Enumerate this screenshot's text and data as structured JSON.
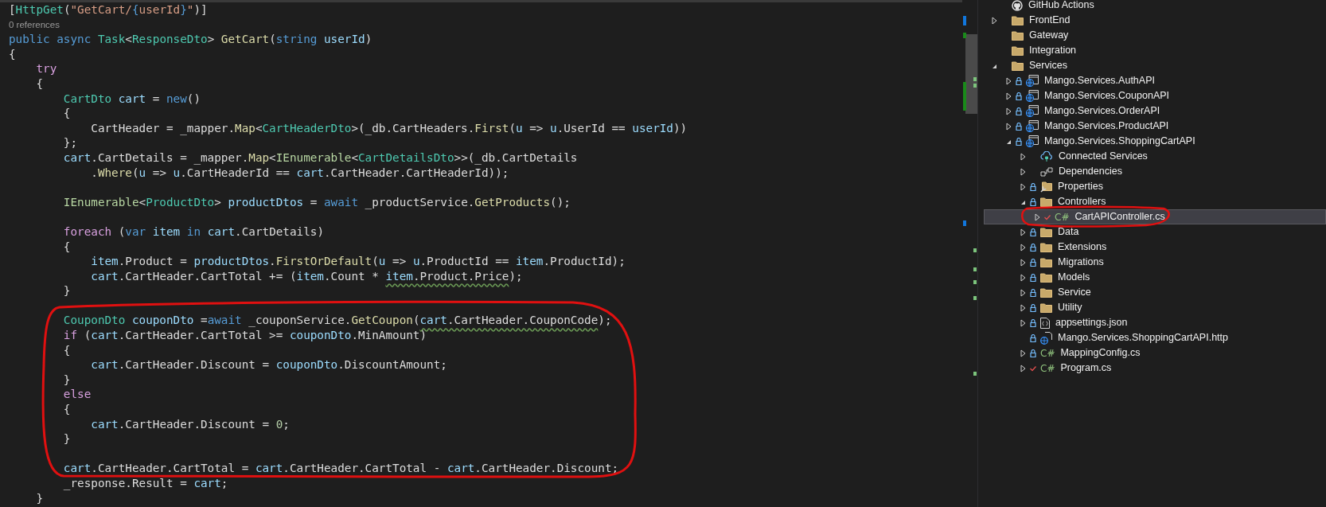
{
  "editor": {
    "lines": [
      {
        "kind": "code",
        "tokens": [
          {
            "text": "[",
            "kind": "plain"
          },
          {
            "text": "HttpGet",
            "kind": "type"
          },
          {
            "text": "(",
            "kind": "plain"
          },
          {
            "text": "\"GetCart/",
            "kind": "string"
          },
          {
            "text": "{",
            "kind": "keyword"
          },
          {
            "text": "userId",
            "kind": "string"
          },
          {
            "text": "}",
            "kind": "keyword"
          },
          {
            "text": "\"",
            "kind": "string"
          },
          {
            "text": ")]",
            "kind": "plain"
          }
        ]
      },
      {
        "kind": "codelens",
        "text": "0 references"
      },
      {
        "kind": "code",
        "tokens": [
          {
            "text": "public async ",
            "kind": "keyword"
          },
          {
            "text": "Task",
            "kind": "type"
          },
          {
            "text": "<",
            "kind": "plain"
          },
          {
            "text": "ResponseDto",
            "kind": "type"
          },
          {
            "text": "> ",
            "kind": "plain"
          },
          {
            "text": "GetCart",
            "kind": "method"
          },
          {
            "text": "(",
            "kind": "plain"
          },
          {
            "text": "string ",
            "kind": "keyword"
          },
          {
            "text": "userId",
            "kind": "variable"
          },
          {
            "text": ")",
            "kind": "plain"
          }
        ]
      },
      {
        "kind": "code",
        "tokens": [
          {
            "text": "{",
            "kind": "plain"
          }
        ]
      },
      {
        "kind": "code",
        "tokens": [
          {
            "text": "    try",
            "kind": "control"
          }
        ]
      },
      {
        "kind": "code",
        "tokens": [
          {
            "text": "    {",
            "kind": "plain"
          }
        ]
      },
      {
        "kind": "code",
        "tokens": [
          {
            "text": "        CartDto",
            "kind": "type"
          },
          {
            "text": " cart",
            "kind": "variable"
          },
          {
            "text": " = ",
            "kind": "plain"
          },
          {
            "text": "new",
            "kind": "keyword"
          },
          {
            "text": "()",
            "kind": "plain"
          }
        ]
      },
      {
        "kind": "code",
        "tokens": [
          {
            "text": "        {",
            "kind": "plain"
          }
        ]
      },
      {
        "kind": "code",
        "tokens": [
          {
            "text": "            CartHeader = _mapper.",
            "kind": "plain"
          },
          {
            "text": "Map",
            "kind": "method"
          },
          {
            "text": "<",
            "kind": "plain"
          },
          {
            "text": "CartHeaderDto",
            "kind": "type"
          },
          {
            "text": ">(_db.CartHeaders.",
            "kind": "plain"
          },
          {
            "text": "First",
            "kind": "method"
          },
          {
            "text": "(",
            "kind": "plain"
          },
          {
            "text": "u",
            "kind": "variable"
          },
          {
            "text": " => ",
            "kind": "plain"
          },
          {
            "text": "u",
            "kind": "variable"
          },
          {
            "text": ".UserId == ",
            "kind": "plain"
          },
          {
            "text": "userId",
            "kind": "variable"
          },
          {
            "text": "))",
            "kind": "plain"
          }
        ]
      },
      {
        "kind": "code",
        "tokens": [
          {
            "text": "        };",
            "kind": "plain"
          }
        ]
      },
      {
        "kind": "code",
        "tokens": [
          {
            "text": "        cart",
            "kind": "variable"
          },
          {
            "text": ".CartDetails = _mapper.",
            "kind": "plain"
          },
          {
            "text": "Map",
            "kind": "method"
          },
          {
            "text": "<",
            "kind": "plain"
          },
          {
            "text": "IEnumerable",
            "kind": "interface"
          },
          {
            "text": "<",
            "kind": "plain"
          },
          {
            "text": "CartDetailsDto",
            "kind": "type"
          },
          {
            "text": ">>(_db.CartDetails",
            "kind": "plain"
          }
        ]
      },
      {
        "kind": "code",
        "tokens": [
          {
            "text": "            .",
            "kind": "plain"
          },
          {
            "text": "Where",
            "kind": "method"
          },
          {
            "text": "(",
            "kind": "plain"
          },
          {
            "text": "u",
            "kind": "variable"
          },
          {
            "text": " => ",
            "kind": "plain"
          },
          {
            "text": "u",
            "kind": "variable"
          },
          {
            "text": ".CartHeaderId == ",
            "kind": "plain"
          },
          {
            "text": "cart",
            "kind": "variable"
          },
          {
            "text": ".CartHeader.CartHeaderId));",
            "kind": "plain"
          }
        ]
      },
      {
        "kind": "blank"
      },
      {
        "kind": "code",
        "tokens": [
          {
            "text": "        IEnumerable",
            "kind": "interface"
          },
          {
            "text": "<",
            "kind": "plain"
          },
          {
            "text": "ProductDto",
            "kind": "type"
          },
          {
            "text": "> ",
            "kind": "plain"
          },
          {
            "text": "productDtos",
            "kind": "variable"
          },
          {
            "text": " = ",
            "kind": "plain"
          },
          {
            "text": "await",
            "kind": "keyword"
          },
          {
            "text": " _productService.",
            "kind": "plain"
          },
          {
            "text": "GetProducts",
            "kind": "method"
          },
          {
            "text": "();",
            "kind": "plain"
          }
        ]
      },
      {
        "kind": "blank"
      },
      {
        "kind": "code",
        "tokens": [
          {
            "text": "        foreach",
            "kind": "control"
          },
          {
            "text": " (",
            "kind": "plain"
          },
          {
            "text": "var ",
            "kind": "keyword"
          },
          {
            "text": "item ",
            "kind": "variable"
          },
          {
            "text": "in ",
            "kind": "keyword"
          },
          {
            "text": "cart",
            "kind": "variable"
          },
          {
            "text": ".CartDetails)",
            "kind": "plain"
          }
        ]
      },
      {
        "kind": "code",
        "tokens": [
          {
            "text": "        {",
            "kind": "plain"
          }
        ]
      },
      {
        "kind": "code",
        "tokens": [
          {
            "text": "            item",
            "kind": "variable"
          },
          {
            "text": ".Product = ",
            "kind": "plain"
          },
          {
            "text": "productDtos",
            "kind": "variable"
          },
          {
            "text": ".",
            "kind": "plain"
          },
          {
            "text": "FirstOrDefault",
            "kind": "method"
          },
          {
            "text": "(",
            "kind": "plain"
          },
          {
            "text": "u",
            "kind": "variable"
          },
          {
            "text": " => ",
            "kind": "plain"
          },
          {
            "text": "u",
            "kind": "variable"
          },
          {
            "text": ".ProductId == ",
            "kind": "plain"
          },
          {
            "text": "item",
            "kind": "variable"
          },
          {
            "text": ".ProductId);",
            "kind": "plain"
          }
        ]
      },
      {
        "kind": "code",
        "tokens": [
          {
            "text": "            cart",
            "kind": "variable"
          },
          {
            "text": ".CartHeader.CartTotal += (",
            "kind": "plain"
          },
          {
            "text": "item",
            "kind": "variable"
          },
          {
            "text": ".Count * ",
            "kind": "plain"
          },
          {
            "text": "item",
            "kind": "variable",
            "squiggle": true
          },
          {
            "text": ".Product.Price",
            "kind": "plain",
            "squiggle": true
          },
          {
            "text": ");",
            "kind": "plain"
          }
        ]
      },
      {
        "kind": "code",
        "tokens": [
          {
            "text": "        }",
            "kind": "plain"
          }
        ]
      },
      {
        "kind": "blank"
      },
      {
        "kind": "code",
        "tokens": [
          {
            "text": "        CouponDto",
            "kind": "type"
          },
          {
            "text": " couponDto",
            "kind": "variable"
          },
          {
            "text": " =",
            "kind": "plain"
          },
          {
            "text": "await",
            "kind": "keyword"
          },
          {
            "text": " _couponService.",
            "kind": "plain"
          },
          {
            "text": "GetCoupon",
            "kind": "method"
          },
          {
            "text": "(",
            "kind": "plain"
          },
          {
            "text": "cart",
            "kind": "variable",
            "squiggle": true
          },
          {
            "text": ".CartHeader.CouponCode",
            "kind": "plain",
            "squiggle": true
          },
          {
            "text": ");",
            "kind": "plain"
          }
        ]
      },
      {
        "kind": "code",
        "tokens": [
          {
            "text": "        if",
            "kind": "control"
          },
          {
            "text": " (",
            "kind": "plain"
          },
          {
            "text": "cart",
            "kind": "variable"
          },
          {
            "text": ".CartHeader.CartTotal >= ",
            "kind": "plain"
          },
          {
            "text": "couponDto",
            "kind": "variable"
          },
          {
            "text": ".MinAmount)",
            "kind": "plain"
          }
        ]
      },
      {
        "kind": "code",
        "tokens": [
          {
            "text": "        {",
            "kind": "plain"
          }
        ]
      },
      {
        "kind": "code",
        "tokens": [
          {
            "text": "            cart",
            "kind": "variable"
          },
          {
            "text": ".CartHeader.Discount = ",
            "kind": "plain"
          },
          {
            "text": "couponDto",
            "kind": "variable"
          },
          {
            "text": ".DiscountAmount;",
            "kind": "plain"
          }
        ]
      },
      {
        "kind": "code",
        "tokens": [
          {
            "text": "        }",
            "kind": "plain"
          }
        ]
      },
      {
        "kind": "code",
        "tokens": [
          {
            "text": "        else",
            "kind": "control"
          }
        ]
      },
      {
        "kind": "code",
        "tokens": [
          {
            "text": "        {",
            "kind": "plain"
          }
        ]
      },
      {
        "kind": "code",
        "tokens": [
          {
            "text": "            cart",
            "kind": "variable"
          },
          {
            "text": ".CartHeader.Discount = ",
            "kind": "plain"
          },
          {
            "text": "0",
            "kind": "number"
          },
          {
            "text": ";",
            "kind": "plain"
          }
        ]
      },
      {
        "kind": "code",
        "tokens": [
          {
            "text": "        }",
            "kind": "plain"
          }
        ]
      },
      {
        "kind": "blank"
      },
      {
        "kind": "code",
        "tokens": [
          {
            "text": "        cart",
            "kind": "variable"
          },
          {
            "text": ".CartHeader.CartTotal = ",
            "kind": "plain"
          },
          {
            "text": "cart",
            "kind": "variable"
          },
          {
            "text": ".CartHeader.CartTotal - ",
            "kind": "plain"
          },
          {
            "text": "cart",
            "kind": "variable"
          },
          {
            "text": ".CartHeader.Discount;",
            "kind": "plain"
          }
        ]
      },
      {
        "kind": "code",
        "tokens": [
          {
            "text": "        _response.Result = ",
            "kind": "plain"
          },
          {
            "text": "cart",
            "kind": "variable"
          },
          {
            "text": ";",
            "kind": "plain"
          }
        ]
      },
      {
        "kind": "code",
        "tokens": [
          {
            "text": "    }",
            "kind": "plain"
          }
        ]
      }
    ]
  },
  "solution_explorer": {
    "items": [
      {
        "label": "GitHub Actions",
        "kind": "github",
        "locked": false,
        "edited": false,
        "selected": false
      },
      {
        "label": "FrontEnd",
        "kind": "folder",
        "expanded": false,
        "locked": false,
        "edited": false,
        "selected": false
      },
      {
        "label": "Gateway",
        "kind": "folder",
        "locked": false,
        "edited": false,
        "selected": false
      },
      {
        "label": "Integration",
        "kind": "folder",
        "locked": false,
        "edited": false,
        "selected": false
      },
      {
        "label": "Services",
        "kind": "folder",
        "expanded": true,
        "locked": false,
        "edited": false,
        "selected": false,
        "children": [
          {
            "label": "Mango.Services.AuthAPI",
            "kind": "project",
            "expanded": false,
            "locked": true,
            "edited": false,
            "selected": false
          },
          {
            "label": "Mango.Services.CouponAPI",
            "kind": "project",
            "expanded": false,
            "locked": true,
            "edited": false,
            "selected": false
          },
          {
            "label": "Mango.Services.OrderAPI",
            "kind": "project",
            "expanded": false,
            "locked": true,
            "edited": false,
            "selected": false
          },
          {
            "label": "Mango.Services.ProductAPI",
            "kind": "project",
            "expanded": false,
            "locked": true,
            "edited": false,
            "selected": false
          },
          {
            "label": "Mango.Services.ShoppingCartAPI",
            "kind": "project",
            "expanded": true,
            "locked": true,
            "edited": false,
            "selected": false,
            "children": [
              {
                "label": "Connected Services",
                "kind": "connected",
                "expanded": false,
                "locked": false,
                "edited": false,
                "selected": false
              },
              {
                "label": "Dependencies",
                "kind": "dependencies",
                "expanded": false,
                "locked": false,
                "edited": false,
                "selected": false
              },
              {
                "label": "Properties",
                "kind": "properties",
                "expanded": false,
                "locked": true,
                "edited": false,
                "selected": false
              },
              {
                "label": "Controllers",
                "kind": "folder",
                "expanded": true,
                "locked": true,
                "edited": false,
                "selected": false,
                "children": [
                  {
                    "label": "CartAPIController.cs",
                    "kind": "csharp",
                    "icon_text": "C#",
                    "expanded": false,
                    "locked": false,
                    "edited": true,
                    "selected": true
                  }
                ]
              },
              {
                "label": "Data",
                "kind": "folder",
                "expanded": false,
                "locked": true,
                "edited": false,
                "selected": false
              },
              {
                "label": "Extensions",
                "kind": "folder",
                "expanded": false,
                "locked": true,
                "edited": false,
                "selected": false
              },
              {
                "label": "Migrations",
                "kind": "folder",
                "expanded": false,
                "locked": true,
                "edited": false,
                "selected": false
              },
              {
                "label": "Models",
                "kind": "folder",
                "expanded": false,
                "locked": true,
                "edited": false,
                "selected": false
              },
              {
                "label": "Service",
                "kind": "folder",
                "expanded": false,
                "locked": true,
                "edited": false,
                "selected": false
              },
              {
                "label": "Utility",
                "kind": "folder",
                "expanded": false,
                "locked": true,
                "edited": false,
                "selected": false
              },
              {
                "label": "appsettings.json",
                "kind": "json",
                "expanded": false,
                "locked": true,
                "edited": false,
                "selected": false
              },
              {
                "label": "Mango.Services.ShoppingCartAPI.http",
                "kind": "http",
                "locked": true,
                "edited": false,
                "selected": false
              },
              {
                "label": "MappingConfig.cs",
                "kind": "csharp",
                "icon_text": "C#",
                "expanded": false,
                "locked": true,
                "edited": false,
                "selected": false
              },
              {
                "label": "Program.cs",
                "kind": "csharp",
                "icon_text": "C#",
                "expanded": false,
                "locked": false,
                "edited": true,
                "selected": false
              }
            ]
          }
        ]
      }
    ]
  }
}
